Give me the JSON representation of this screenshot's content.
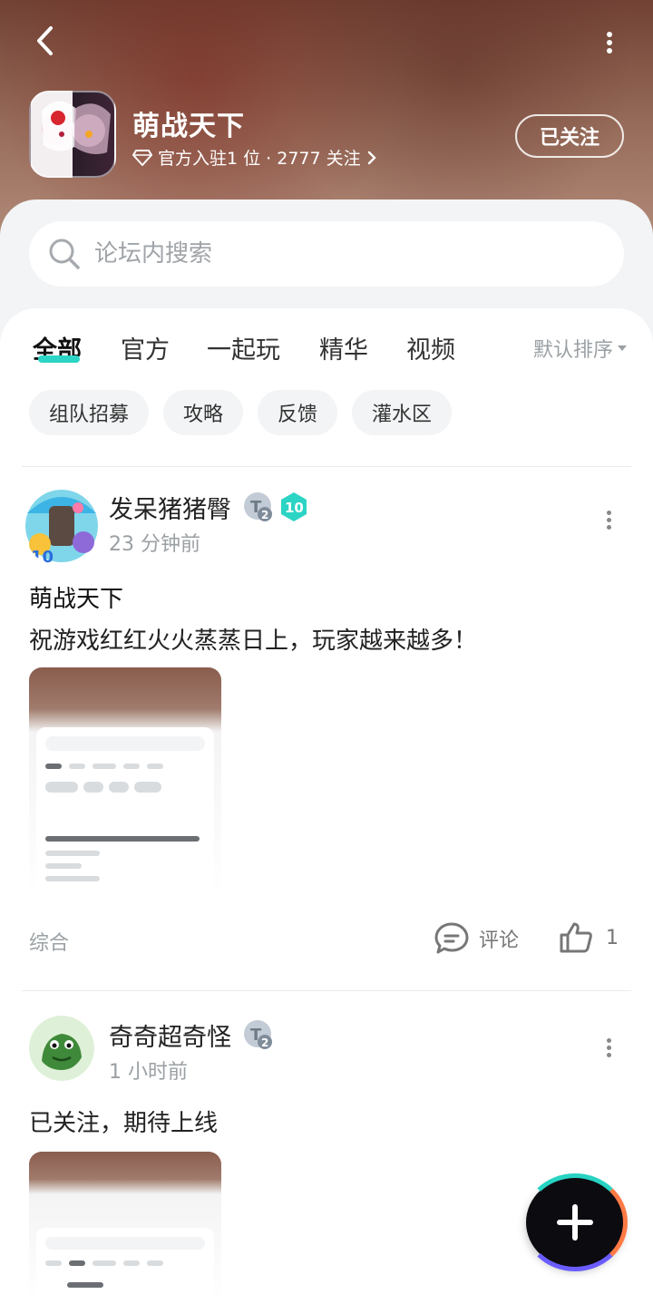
{
  "header": {
    "title": "萌战天下",
    "subtitle": "官方入驻1 位 · 2777 关注",
    "follow_label": "已关注"
  },
  "search": {
    "placeholder": "论坛内搜索"
  },
  "tabs": [
    {
      "label": "全部",
      "active": true
    },
    {
      "label": "官方",
      "active": false
    },
    {
      "label": "一起玩",
      "active": false
    },
    {
      "label": "精华",
      "active": false
    },
    {
      "label": "视频",
      "active": false
    }
  ],
  "sort_label": "默认排序",
  "chips": [
    "组队招募",
    "攻略",
    "反馈",
    "灌水区"
  ],
  "posts": [
    {
      "author": "发呆猪猪臀",
      "time": "23 分钟前",
      "title": "萌战天下",
      "body": "祝游戏红红火火蒸蒸日上，玩家越来越多！",
      "level_badge": "10",
      "tag": "综合",
      "comment_label": "评论",
      "like_count": "1"
    },
    {
      "author": "奇奇超奇怪",
      "time": "1 小时前",
      "body": "已关注，期待上线"
    }
  ],
  "colors": {
    "accent": "#2bd4c4",
    "chip_bg": "#f2f4f5",
    "muted": "#9aa0a4"
  }
}
